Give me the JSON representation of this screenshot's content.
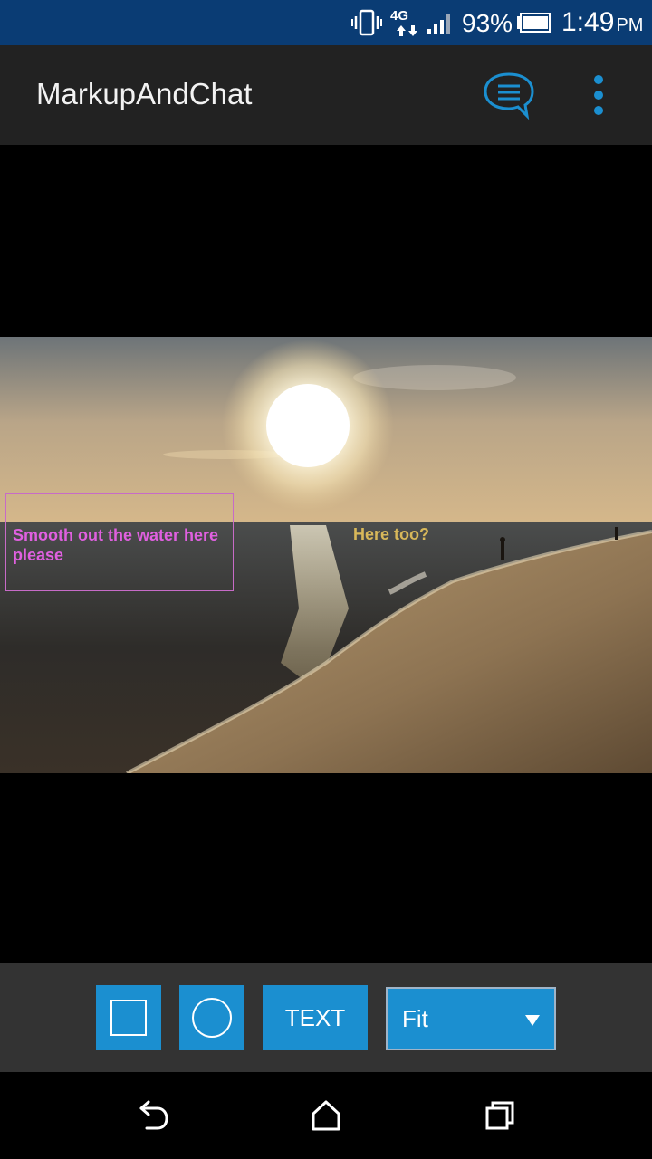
{
  "status_bar": {
    "network": "4G",
    "battery_percent": "93%",
    "time": "1:49",
    "ampm": "PM",
    "icons": [
      "vibrate-icon",
      "network-4g-icon",
      "signal-icon",
      "battery-icon"
    ]
  },
  "app_bar": {
    "title": "MarkupAndChat",
    "icons": [
      "chat-icon",
      "overflow-menu-icon"
    ],
    "accent_color": "#1b8fd0"
  },
  "canvas": {
    "annotations": [
      {
        "type": "rectangle",
        "text": "Smooth out the water here please",
        "color": "#e060e0"
      },
      {
        "type": "text",
        "text": "Here too?",
        "color": "#d8b85a"
      }
    ]
  },
  "toolbar": {
    "rectangle_tool": "rectangle-tool-icon",
    "circle_tool": "circle-tool-icon",
    "text_label": "TEXT",
    "zoom_value": "Fit",
    "button_color": "#1b8fd0"
  },
  "nav_bar": {
    "icons": [
      "back-icon",
      "home-icon",
      "recents-icon"
    ]
  }
}
